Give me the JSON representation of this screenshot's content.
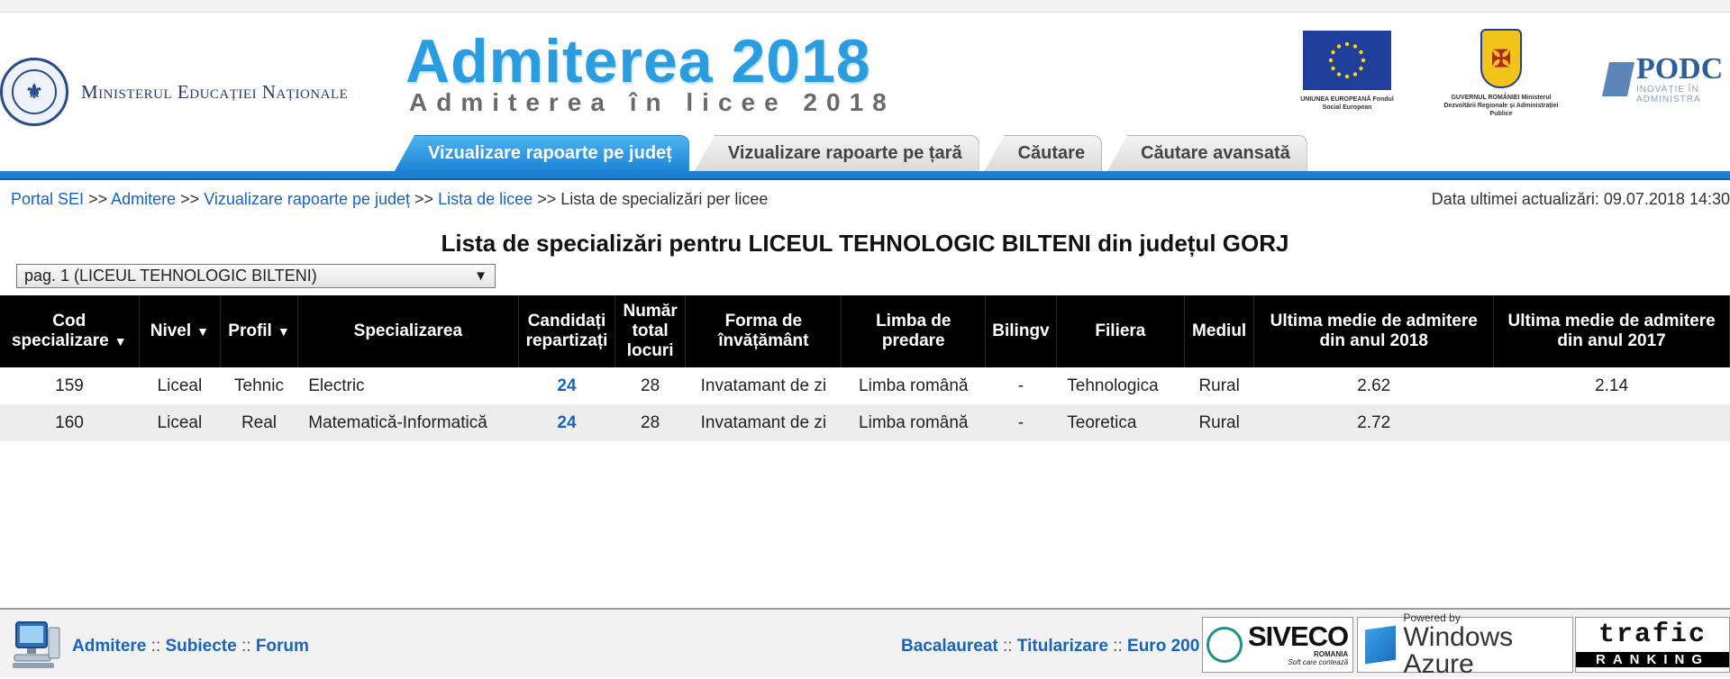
{
  "header": {
    "ministry_name": "Ministerul Educației Naționale",
    "seal_label": "GUVERNUL ROMÂNIEI",
    "brand_title": "Admiterea 2018",
    "brand_subtitle": "Admiterea în licee 2018",
    "eu_caption": "UNIUNEA EUROPEANĂ Fondul Social European",
    "gov_caption": "GUVERNUL ROMÂNIEI Ministerul Dezvoltării Regionale și Administrației Publice",
    "podc_name": "PODC",
    "podc_tagline": "INOVAȚIE ÎN ADMINISTRA"
  },
  "tabs": [
    {
      "label": "Vizualizare rapoarte pe județ",
      "active": true
    },
    {
      "label": "Vizualizare rapoarte pe țară",
      "active": false
    },
    {
      "label": "Căutare",
      "active": false
    },
    {
      "label": "Căutare avansată",
      "active": false
    }
  ],
  "breadcrumb": {
    "items": [
      "Portal SEI",
      "Admitere",
      "Vizualizare rapoarte pe județ",
      "Lista de licee"
    ],
    "separator": ">>",
    "current": "Lista de specializări per licee"
  },
  "last_update": "Data ultimei actualizări: 09.07.2018 14:30",
  "page_title": "Lista de specializări pentru LICEUL TEHNOLOGIC BILTENI din județul GORJ",
  "page_select": {
    "value": "pag. 1 (LICEUL TEHNOLOGIC BILTENI)",
    "arrow": "▼"
  },
  "table": {
    "headers": {
      "cod": "Cod specializare",
      "nivel": "Nivel",
      "profil": "Profil",
      "specializarea": "Specializarea",
      "candidati": "Candidați repartizați",
      "numar": "Număr total locuri",
      "forma": "Forma de învățământ",
      "limba": "Limba de predare",
      "bilingv": "Bilingv",
      "filiera": "Filiera",
      "mediul": "Mediul",
      "medie2018": "Ultima medie de admitere din anul 2018",
      "medie2017": "Ultima medie de admitere din anul 2017"
    },
    "sort_glyph": "▼",
    "rows": [
      {
        "cod": "159",
        "nivel": "Liceal",
        "profil": "Tehnic",
        "specializarea": "Electric",
        "candidati": "24",
        "numar": "28",
        "forma": "Invatamant de zi",
        "limba": "Limba română",
        "bilingv": "-",
        "filiera": "Tehnologica",
        "mediul": "Rural",
        "medie2018": "2.62",
        "medie2017": "2.14"
      },
      {
        "cod": "160",
        "nivel": "Liceal",
        "profil": "Real",
        "specializarea": "Matematică-Informatică",
        "candidati": "24",
        "numar": "28",
        "forma": "Invatamant de zi",
        "limba": "Limba română",
        "bilingv": "-",
        "filiera": "Teoretica",
        "mediul": "Rural",
        "medie2018": "2.72",
        "medie2017": ""
      }
    ]
  },
  "footer": {
    "left_links": [
      "Admitere",
      "Subiecte",
      "Forum"
    ],
    "right_links": [
      "Bacalaureat",
      "Titularizare",
      "Euro 200"
    ],
    "link_separator": "::",
    "siveco": {
      "name": "SIVECO",
      "country": "ROMANIA",
      "tagline": "Soft care contează"
    },
    "azure": {
      "powered": "Powered by",
      "name": "Windows Azure"
    },
    "trafic": {
      "name": "trafic",
      "rank": "RANKING"
    }
  },
  "colors": {
    "accent": "#1b7fd2",
    "link": "#1565c0",
    "table_header": "#000000",
    "brand": "#2a9ce0"
  }
}
